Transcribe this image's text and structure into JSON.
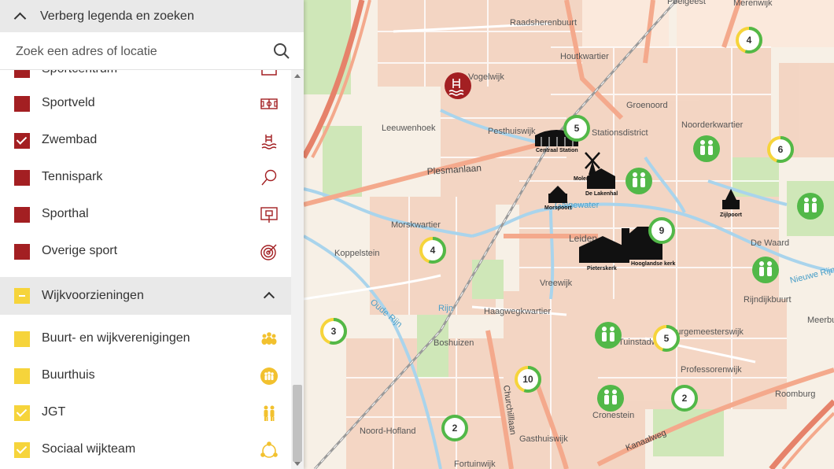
{
  "panel": {
    "toggle_label": "Verberg legenda en zoeken",
    "search": {
      "placeholder": "Zoek een adres of locatie"
    },
    "sport_items": [
      {
        "label": "Sportcentrum",
        "checked": false,
        "icon": "sportcentrum-icon"
      },
      {
        "label": "Sportveld",
        "checked": false,
        "icon": "sports-field-icon"
      },
      {
        "label": "Zwembad",
        "checked": true,
        "icon": "swimming-pool-icon"
      },
      {
        "label": "Tennispark",
        "checked": false,
        "icon": "tennis-racket-icon"
      },
      {
        "label": "Sporthal",
        "checked": false,
        "icon": "sports-hall-icon"
      },
      {
        "label": "Overige sport",
        "checked": false,
        "icon": "target-icon"
      }
    ],
    "category": {
      "label": "Wijkvoorzieningen",
      "state": "partial"
    },
    "wijk_items": [
      {
        "label": "Buurt- en wijkverenigingen",
        "checked": false,
        "icon": "group-icon"
      },
      {
        "label": "Buurthuis",
        "checked": false,
        "icon": "community-house-icon"
      },
      {
        "label": "JGT",
        "checked": true,
        "icon": "family-icon"
      },
      {
        "label": "Sociaal wijkteam",
        "checked": true,
        "icon": "team-circle-icon"
      }
    ]
  },
  "colors": {
    "sport": "#a31f22",
    "wijk": "#f6d43b",
    "cluster_ring": "#52b848",
    "cluster_ring_partial_yellow": "#f6d43b",
    "cluster_ring_partial_red": "#c0392b"
  },
  "map": {
    "place_labels": [
      "Poelgeest",
      "Merenwijk",
      "Raadsherenbuurt",
      "Houtkwartier",
      "Vogelwijk",
      "Groenoord",
      "Leeuwenhoek",
      "Pesthuiswijk",
      "Noorderkwartier",
      "Plesmanlaan",
      "Morskwartier",
      "Koppelstein",
      "De Waard",
      "Leiden",
      "Vreewijk",
      "Rijndijkbuurt",
      "Meerburg",
      "Haagwegkwartier",
      "Boshuizen",
      "Burgemeesterswijk",
      "Professorenwijk",
      "Noord-Hofland",
      "Cronestein",
      "Roomburg",
      "Gasthuiswijk",
      "Fortuinwijk",
      "Tuinstadwijk",
      "Stationsdistrict"
    ],
    "road_labels": [
      "Plesmanlaan",
      "Churchilllaan",
      "Kanaalweg"
    ],
    "water_labels": [
      "Oude Rijn",
      "Rijn",
      "Nieuwe Rijn",
      "Galgewater"
    ],
    "landmarks": [
      "Centraal Station",
      "Molen",
      "De Lakenhal",
      "Morspoort",
      "Zijlpoort",
      "Pieterskerk",
      "Hooglandse kerk"
    ],
    "clusters": [
      {
        "count": "4",
        "ring": "mixed"
      },
      {
        "count": "5",
        "ring": "green"
      },
      {
        "count": "6",
        "ring": "mixed"
      },
      {
        "count": "9",
        "ring": "green"
      },
      {
        "count": "4",
        "ring": "mixed"
      },
      {
        "count": "3",
        "ring": "mixed"
      },
      {
        "count": "5",
        "ring": "mixed"
      },
      {
        "count": "10",
        "ring": "mixed"
      },
      {
        "count": "2",
        "ring": "green"
      },
      {
        "count": "2",
        "ring": "green"
      }
    ],
    "poi_markers": [
      "swimming-pool-marker",
      "jgt-marker",
      "jgt-marker",
      "jgt-marker",
      "jgt-marker",
      "jgt-marker",
      "jgt-marker"
    ]
  }
}
